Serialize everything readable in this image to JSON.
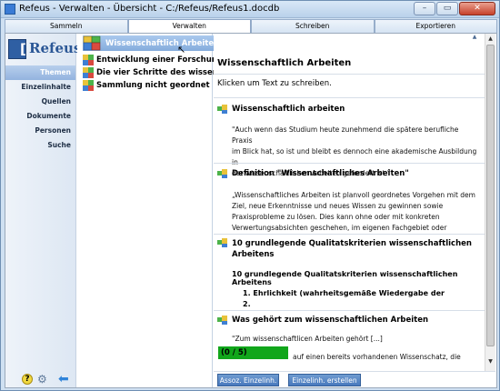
{
  "window": {
    "title": "Refeus - Verwalten - Übersicht - C:/Refeus/Refeus1.docdb",
    "buttons": [
      "–",
      "▭",
      "✕"
    ]
  },
  "tabs": [
    {
      "label": "Sammeln",
      "active": false
    },
    {
      "label": "Verwalten",
      "active": true
    },
    {
      "label": "Schreiben",
      "active": false
    },
    {
      "label": "Exportieren",
      "active": false
    }
  ],
  "sidebar": {
    "logo": {
      "bracket": "[",
      "text": "Refeus"
    },
    "items": [
      {
        "label": "Themen",
        "active": true
      },
      {
        "label": "Einzelinhalte"
      },
      {
        "label": "Quellen"
      },
      {
        "label": "Dokumente"
      },
      {
        "label": "Personen"
      },
      {
        "label": "Suche"
      }
    ],
    "bottom": {
      "help": "?",
      "gear": "⚙",
      "back": "⬅"
    }
  },
  "tree": {
    "items": [
      {
        "label": "Wissenschaftlich Arbeiten",
        "selected": true
      },
      {
        "label": "Entwicklung einer Forschungsf"
      },
      {
        "label": "Die vier Schritte des wissensch"
      },
      {
        "label": "Sammlung nicht geordnet"
      }
    ]
  },
  "content": {
    "title": "Wissenschaftlich Arbeiten",
    "hint": "Klicken um Text zu schreiben.",
    "sections": [
      {
        "heading": "Wissenschaftlich arbeiten",
        "lines": [
          "\"Auch wenn das Studium heute zunehmend die spätere berufliche Praxis",
          "im Blick hat, so ist und bleibt es dennoch eine akademische Ausbildung in",
          "der wissenschaftlichen Arbeiten gefordert ist.\""
        ]
      },
      {
        "heading": "Definition \"Wissenschaftliches Arbeiten\"",
        "lines": [
          "„Wissenschaftliches Arbeiten ist planvoll geordnetes Vorgehen mit dem",
          "Ziel, neue Erkenntnisse und neues Wissen zu gewinnen sowie",
          "Praxisprobleme zu lösen. Dies kann ohne oder mit konkreten",
          "Verwertungsabsichten geschehen, im eigenen Fachgebiet oder"
        ]
      },
      {
        "heading": "10 grundlegende Qualitatskriterien wissenschaftlichen Arbeitens",
        "subheading": "10 grundlegende Qualitatskriterien wissenschaftlichen Arbeitens",
        "items": [
          {
            "num": "1.",
            "text": "Ehrlichkeit (wahrheitsgemäße Wiedergabe der"
          },
          {
            "num": "2.",
            "text": ""
          }
        ]
      },
      {
        "heading": "Was gehört zum wissenschaftlichen Arbeiten",
        "lines": [
          "\"Zum wissenschaftlicen Arbeiten gehört [...]"
        ],
        "progress_label": "(0 / 5)",
        "progress": 0,
        "partial": "auf einen bereits vorhandenen Wissenschatz, die"
      }
    ],
    "buttons": [
      "Assoz. Einzelinh.",
      "Einzelinh. erstellen"
    ]
  },
  "colors": {
    "accent": "#4879bd",
    "progress": "#11a61b",
    "selection": "#85acdc"
  }
}
